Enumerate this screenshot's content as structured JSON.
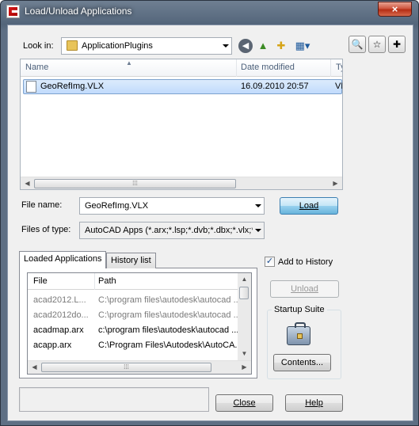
{
  "window": {
    "title": "Load/Unload Applications",
    "close_glyph": "×"
  },
  "lookin": {
    "label": "Look in:",
    "value": "ApplicationPlugins"
  },
  "filelist": {
    "columns": [
      "Name",
      "Date modified",
      "Ty"
    ],
    "rows": [
      {
        "name": "GeoRefImg.VLX",
        "date": "16.09.2010 20:57",
        "type": "VL"
      }
    ]
  },
  "filename": {
    "label": "File name:",
    "value": "GeoRefImg.VLX"
  },
  "filetype": {
    "label": "Files of type:",
    "value": "AutoCAD Apps (*.arx;*.lsp;*.dvb;*.dbx;*.vlx;*.;"
  },
  "buttons": {
    "load": "Load",
    "unload": "Unload",
    "contents": "Contents...",
    "close": "Close",
    "help": "Help"
  },
  "tabs": {
    "loaded": "Loaded Applications",
    "history": "History list"
  },
  "loaded": {
    "columns": [
      "File",
      "Path"
    ],
    "rows": [
      {
        "file": "acad2012.L...",
        "path": "C:\\program files\\autodesk\\autocad ...",
        "muted": true
      },
      {
        "file": "acad2012do...",
        "path": "C:\\program files\\autodesk\\autocad ...",
        "muted": true
      },
      {
        "file": "acadmap.arx",
        "path": "c:\\program files\\autodesk\\autocad ...",
        "muted": false
      },
      {
        "file": "acapp.arx",
        "path": "C:\\Program Files\\Autodesk\\AutoCA...",
        "muted": false
      }
    ]
  },
  "add_history": {
    "label": "Add to History",
    "checked": true,
    "check_glyph": "✓"
  },
  "startup": {
    "label": "Startup Suite"
  }
}
